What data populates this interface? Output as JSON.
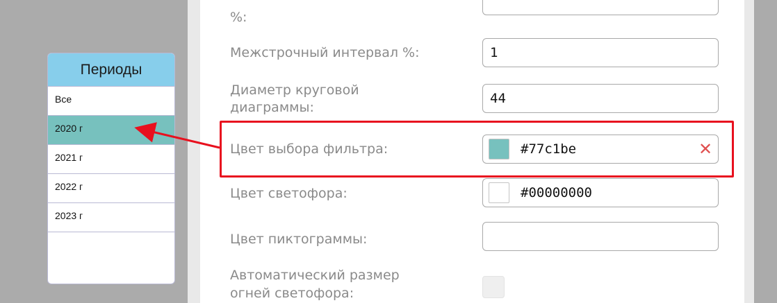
{
  "periods": {
    "title": "Периоды",
    "items": [
      {
        "label": "Все",
        "selected": false
      },
      {
        "label": "2020 г",
        "selected": true
      },
      {
        "label": "2021 г",
        "selected": false
      },
      {
        "label": "2022 г",
        "selected": false
      },
      {
        "label": "2023 г",
        "selected": false
      }
    ]
  },
  "settings": {
    "top_partial_label": "%:",
    "line_spacing": {
      "label": "Межстрочный интервал %:",
      "value": "1"
    },
    "pie_diameter": {
      "label_line1": "Диаметр круговой",
      "label_line2": "диаграммы:",
      "value": "44"
    },
    "filter_color": {
      "label": "Цвет выбора фильтра:",
      "value": "#77c1be",
      "swatch_color": "#77c1be"
    },
    "traffic_light_color": {
      "label": "Цвет светофора:",
      "value": "#00000000",
      "swatch_color": "#ffffff"
    },
    "pictogram_color": {
      "label": "Цвет пиктограммы:",
      "value": ""
    },
    "auto_light_size": {
      "label_line1": "Автоматический размер",
      "label_line2": "огней светофора:",
      "checked": false
    }
  },
  "colors": {
    "highlight": "#e8101e",
    "selected_period": "#77c1be",
    "periods_header": "#87ceeb"
  }
}
